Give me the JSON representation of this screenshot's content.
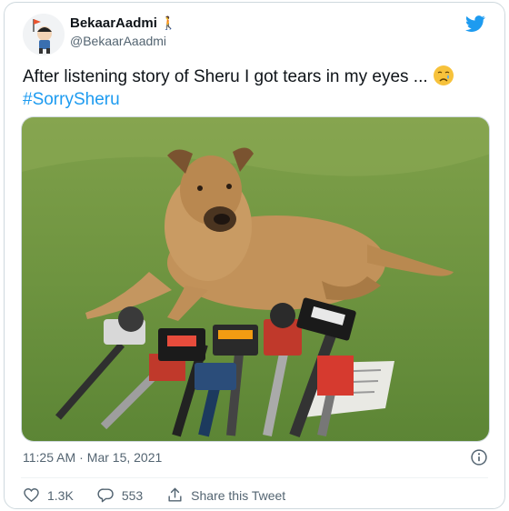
{
  "tweet": {
    "display_name": "BekaarAadmi",
    "name_emoji": "🚶",
    "handle": "@BekaarAaadmi",
    "text": "After listening story of Sheru I got tears in my eyes ...",
    "hashtag": "#SorrySheru",
    "time": "11:25 AM",
    "separator": "·",
    "date": "Mar 15, 2021"
  },
  "actions": {
    "likes": "1.3K",
    "replies": "553",
    "share_label": "Share this Tweet"
  },
  "icons": {
    "brand": "twitter-bird-icon",
    "info": "info-icon",
    "like": "heart-icon",
    "reply": "reply-icon",
    "share": "share-icon"
  },
  "colors": {
    "brand_blue": "#1d9bf0",
    "secondary_text": "#536471",
    "border": "#cfd9de"
  }
}
